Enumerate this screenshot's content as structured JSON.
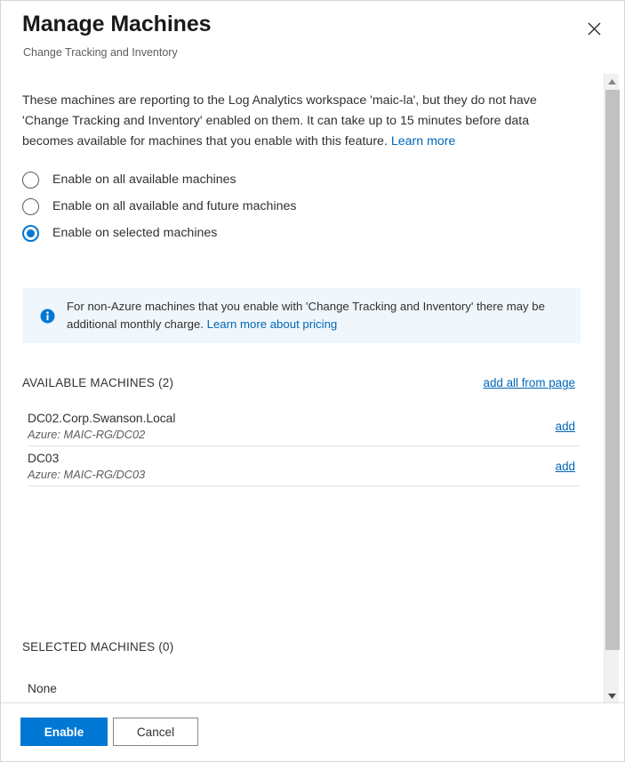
{
  "dialog": {
    "title": "Manage Machines",
    "subtitle": "Change Tracking and Inventory",
    "close_label": "Close"
  },
  "description": {
    "text": "These machines are reporting to the Log Analytics workspace 'maic-la', but they do not have 'Change Tracking and Inventory' enabled on them. It can take up to 15 minutes before data becomes available for machines that you enable with this feature.",
    "link_label": "Learn more"
  },
  "radio_options": [
    {
      "label": "Enable on all available machines",
      "selected": false
    },
    {
      "label": "Enable on all available and future machines",
      "selected": false
    },
    {
      "label": "Enable on selected machines",
      "selected": true
    }
  ],
  "info_banner": {
    "icon": "info-icon",
    "text": "For non-Azure machines that you enable with 'Change Tracking and Inventory' there may be additional monthly charge.",
    "link_label": "Learn more about pricing",
    "background_color": "#eff6fc",
    "icon_color": "#0078d4"
  },
  "available_machines": {
    "heading": "AVAILABLE MACHINES (2)",
    "add_all_label": "add all from page",
    "rows": [
      {
        "name": "DC02.Corp.Swanson.Local",
        "subtitle": "Azure: MAIC-RG/DC02",
        "action_label": "add"
      },
      {
        "name": "DC03",
        "subtitle": "Azure: MAIC-RG/DC03",
        "action_label": "add"
      }
    ]
  },
  "selected_machines": {
    "heading": "SELECTED MACHINES (0)",
    "empty_label": "None"
  },
  "footer": {
    "primary_label": "Enable",
    "secondary_label": "Cancel"
  },
  "scrollbar": {
    "up_arrow": "triangle-up-icon",
    "down_arrow": "triangle-down-icon"
  },
  "colors": {
    "accent": "#0078d4",
    "link": "#0067b8",
    "text": "#323130",
    "muted": "#605e5c"
  }
}
